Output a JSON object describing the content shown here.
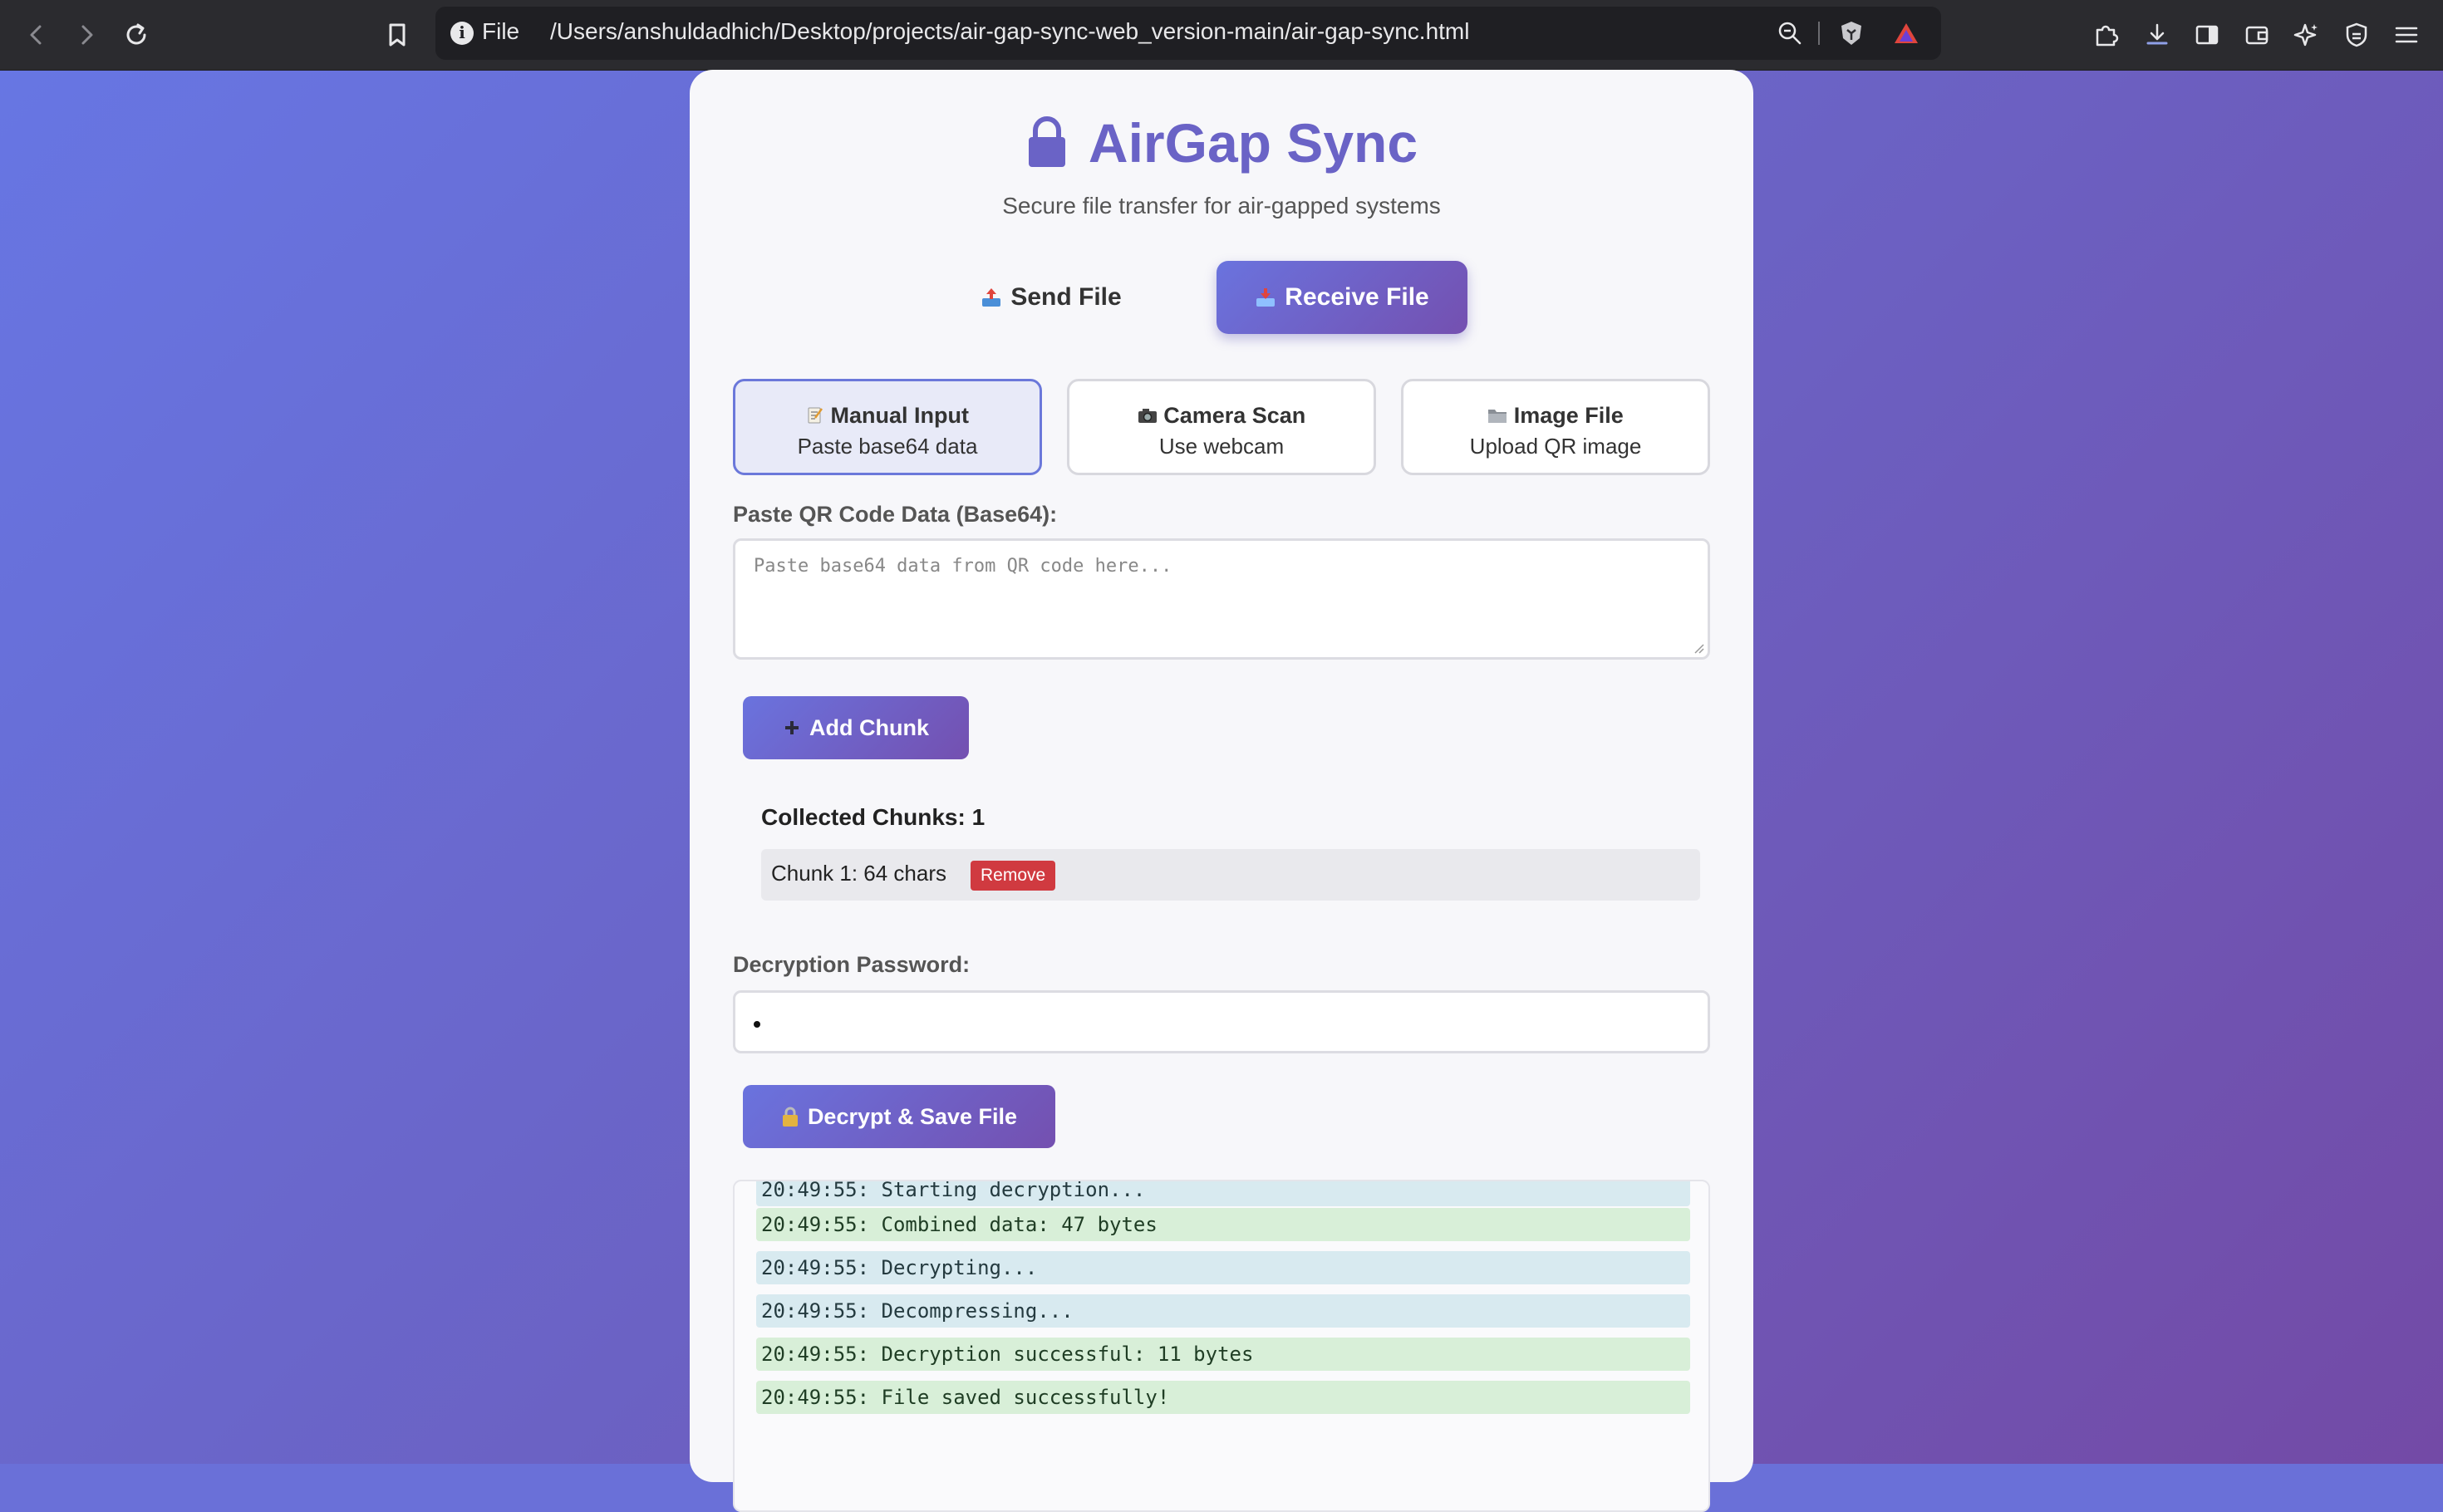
{
  "browser": {
    "url_scheme": "File",
    "url_path": "/Users/anshuldadhich/Desktop/projects/air-gap-sync-web_version-main/air-gap-sync.html"
  },
  "app": {
    "title": "AirGap Sync",
    "subtitle": "Secure file transfer for air-gapped systems"
  },
  "tabs": [
    {
      "label": "Send File",
      "icon": "outbox-tray-icon",
      "active": false
    },
    {
      "label": "Receive File",
      "icon": "inbox-tray-icon",
      "active": true
    }
  ],
  "methods": [
    {
      "title": "Manual Input",
      "subtitle": "Paste base64 data",
      "icon": "memo-icon",
      "active": true
    },
    {
      "title": "Camera Scan",
      "subtitle": "Use webcam",
      "icon": "camera-icon",
      "active": false
    },
    {
      "title": "Image File",
      "subtitle": "Upload QR image",
      "icon": "folder-icon",
      "active": false
    }
  ],
  "qr_input": {
    "label": "Paste QR Code Data (Base64):",
    "placeholder": "Paste base64 data from QR code here...",
    "value": ""
  },
  "add_chunk": {
    "label": "Add Chunk",
    "icon": "plus-icon"
  },
  "chunks": {
    "heading": "Collected Chunks: 1",
    "items": [
      {
        "text": "Chunk 1: 64 chars",
        "remove_label": "Remove"
      }
    ]
  },
  "password": {
    "label": "Decryption Password:",
    "masked_value": "•"
  },
  "decrypt": {
    "label": "Decrypt & Save File",
    "icon": "lock-icon"
  },
  "log": [
    {
      "text": "20:49:55: Starting decryption...",
      "type": "info"
    },
    {
      "text": "20:49:55: Combined data: 47 bytes",
      "type": "success"
    },
    {
      "text": "20:49:55: Decrypting...",
      "type": "info"
    },
    {
      "text": "20:49:55: Decompressing...",
      "type": "info"
    },
    {
      "text": "20:49:55: Decryption successful: 11 bytes",
      "type": "success"
    },
    {
      "text": "20:49:55: File saved successfully!",
      "type": "success"
    }
  ],
  "colors": {
    "accent_start": "#6a73de",
    "accent_end": "#7450b0",
    "title": "#6a63c6",
    "danger": "#d03a40",
    "log_info": "#d8eaf0",
    "log_success": "#d8efd8"
  }
}
